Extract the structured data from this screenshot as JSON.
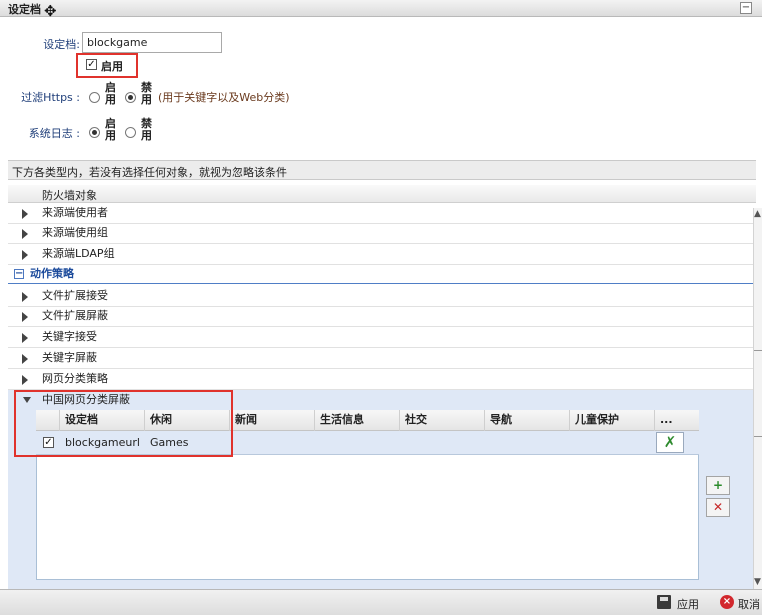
{
  "window": {
    "title": "设定档",
    "collapse_glyph": "−"
  },
  "form": {
    "name_label": "设定档:",
    "name_value": "blockgame",
    "enable_label": "启用",
    "filter_https_label": "过滤Https :",
    "https_enable": "启用",
    "https_disable": "禁用",
    "https_note": "(用于关键字以及Web分类)",
    "syslog_label": "系统日志 :",
    "syslog_enable": "启用",
    "syslog_disable": "禁用"
  },
  "info_text": "下方各类型内，若没有选择任何对象，就视为忽略该条件",
  "tree": {
    "header": "防火墙对象",
    "top_items": [
      "来源端使用者",
      "来源端使用组",
      "来源端LDAP组"
    ],
    "section_title": "动作策略",
    "section_toggle": "−",
    "action_items": [
      "文件扩展接受",
      "文件扩展屏蔽",
      "关键字接受",
      "关键字屏蔽",
      "网页分类策略"
    ],
    "expanded_item": "中国网页分类屏蔽"
  },
  "grid": {
    "columns": [
      "设定档",
      "休闲",
      "新闻",
      "生活信息",
      "社交",
      "导航",
      "儿童保护",
      "..."
    ],
    "rows": [
      {
        "checked": "✓",
        "name": "blockgameurl",
        "leisure": "Games",
        "tool_icon": "✗"
      }
    ]
  },
  "side_buttons": {
    "add_glyph": "+",
    "delete_glyph": "✕"
  },
  "footer": {
    "apply_label": "应用",
    "cancel_label": "取消",
    "cancel_glyph": "×"
  },
  "icons": [
    "move-icon",
    "save-icon",
    "cancel-icon",
    "add-icon",
    "delete-icon",
    "tools-icon",
    "expand-arrow-icon"
  ],
  "colors": {
    "highlight_red": "#e0322c",
    "label_blue": "#1f3e79",
    "section_blue": "#1c4b9c",
    "selected_bg": "#dfe8f6"
  }
}
